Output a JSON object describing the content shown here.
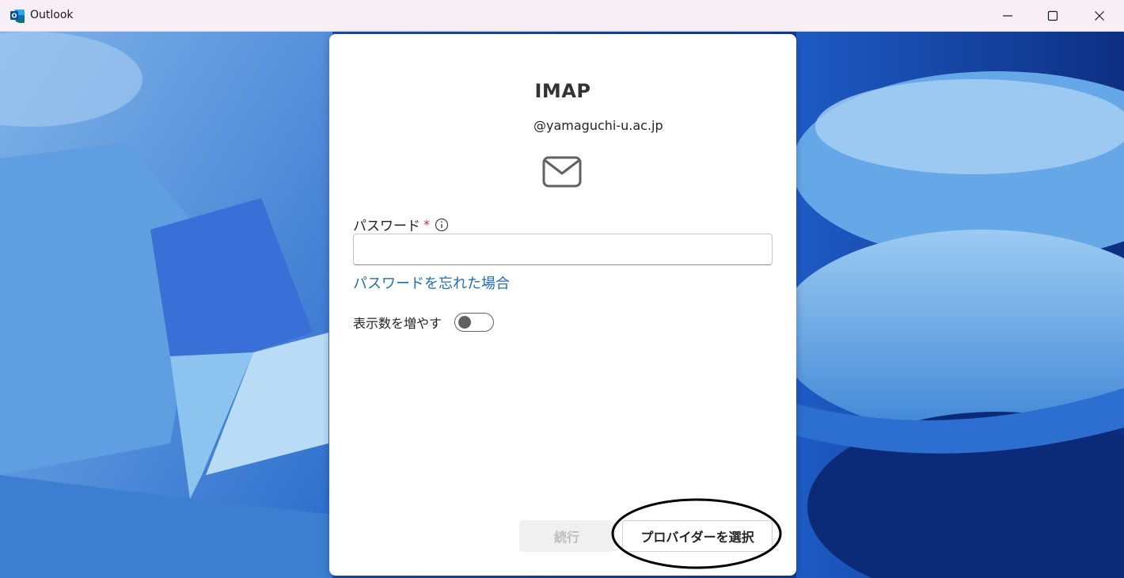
{
  "window": {
    "title": "Outlook",
    "app_icon": "outlook-icon",
    "controls": [
      "minimize-icon",
      "maximize-icon",
      "close-icon"
    ]
  },
  "dialog": {
    "title": "IMAP",
    "email": "@yamaguchi-u.ac.jp",
    "icon": "mail-icon",
    "password_label": "パスワード",
    "required_mark": "*",
    "password_value": "",
    "forgot_password_link": "パスワードを忘れた場合",
    "show_more_label": "表示数を増やす",
    "show_more_enabled": false,
    "continue_button": "続行",
    "choose_provider_button": "プロバイダーを選択"
  },
  "colors": {
    "accent_link": "#1f6fb8",
    "required": "#c4314b",
    "annotation": "#000000"
  }
}
